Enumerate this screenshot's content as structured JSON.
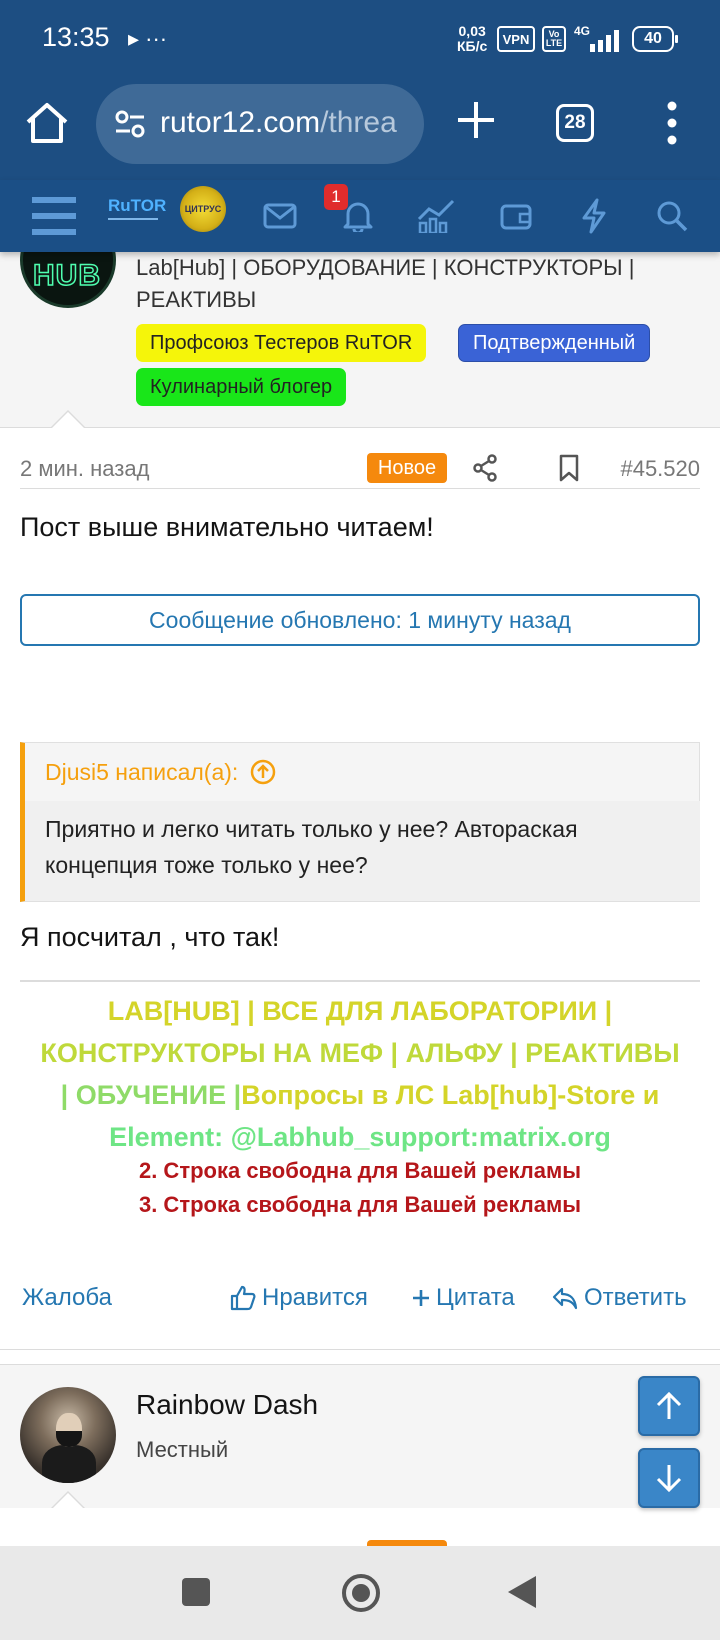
{
  "status_bar": {
    "time": "13:35",
    "extra_icons": "▸ ···",
    "speed_value": "0,03",
    "speed_unit": "КБ/с",
    "vpn": "VPN",
    "volte_top": "Vo",
    "volte_bottom": "LTE",
    "network": "4G",
    "battery": "40"
  },
  "browser": {
    "url_host": "rutor12.com",
    "url_path": "/threa",
    "tabs_count": "28"
  },
  "site_nav": {
    "notification_count": "1",
    "logo_text": "RuTOR",
    "citrus_text": "ЦИТРУС"
  },
  "author_top": {
    "avatar_text": "HUB",
    "title_line1": "Lab[Hub] | ОБОРУДОВАНИЕ | КОНСТРУКТОРЫ |",
    "title_line2": "РЕАКТИВЫ",
    "badges": [
      {
        "label": "Профсоюз Тестеров RuTOR",
        "bg": "#f5f50a",
        "color": "#222222"
      },
      {
        "label": "Подтвержденный",
        "bg": "#3a63d6",
        "color": "#ffffff"
      },
      {
        "label": "Кулинарный блогер",
        "bg": "#19e619",
        "color": "#222222"
      }
    ]
  },
  "post": {
    "time": "2 мин. назад",
    "new_label": "Новое",
    "number": "#45.520",
    "text1": "Пост выше внимательно читаем!",
    "edit_notice": "Сообщение обновлено: 1 минуту назад",
    "quote_author": "Djusi5 написал(а):",
    "quote_text": "Приятно и легко читать только у нее? Автораская концепция тоже только у нее?",
    "text2": "Я посчитал , что так!",
    "signature": {
      "part1": "LAB[HUB] | ВСЕ ДЛЯ ЛАБОРАТОРИИ |",
      "part2": "КОНСТРУКТОРЫ НА МЕФ | АЛЬФУ | РЕАКТИВЫ",
      "part3": "| ОБУЧЕНИЕ |",
      "part4": "Вопросы в ЛС Lab[hub]-Store и",
      "part5": "Element: @Labhub_support:matrix.org",
      "ad2": "2. Строка свободна для Вашей рекламы",
      "ad3": "3. Строка свободна для Вашей рекламы"
    },
    "actions": {
      "report": "Жалоба",
      "like": "Нравится",
      "quote": "Цитата",
      "reply": "Ответить"
    }
  },
  "next_author": {
    "name": "Rainbow Dash",
    "role": "Местный"
  },
  "colors": {
    "header_bg": "#1d4e82",
    "link": "#2577b1",
    "quote_accent": "#f5a00e",
    "new_badge": "#f5890d"
  }
}
